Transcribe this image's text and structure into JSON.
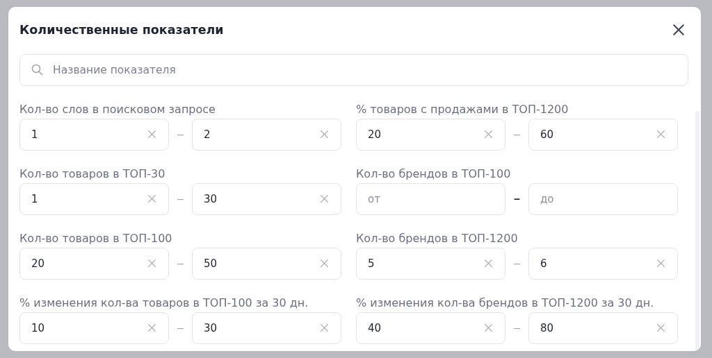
{
  "dialog": {
    "title": "Количественные показатели",
    "search": {
      "placeholder": "Название показателя"
    },
    "filters": [
      {
        "label": "Кол-во слов в поисковом запросе",
        "from": {
          "value": "1"
        },
        "separator": "–",
        "to": {
          "value": "2"
        }
      },
      {
        "label": "% товаров с продажами в ТОП-1200",
        "from": {
          "value": "20"
        },
        "separator": "–",
        "to": {
          "value": "60"
        }
      },
      {
        "label": "Кол-во товаров в ТОП-30",
        "from": {
          "value": "1"
        },
        "separator": "–",
        "to": {
          "value": "30"
        }
      },
      {
        "label": "Кол-во брендов в ТОП-100",
        "from": {
          "placeholder": "от"
        },
        "separator": "–",
        "to": {
          "placeholder": "до"
        }
      },
      {
        "label": "Кол-во товаров в ТОП-100",
        "from": {
          "value": "20"
        },
        "separator": "–",
        "to": {
          "value": "50"
        }
      },
      {
        "label": "Кол-во брендов в ТОП-1200",
        "from": {
          "value": "5"
        },
        "separator": "–",
        "to": {
          "value": "6"
        }
      },
      {
        "label": "% изменения кол-ва товаров в ТОП-100 за 30 дн.",
        "from": {
          "value": "10"
        },
        "separator": "–",
        "to": {
          "value": "30"
        }
      },
      {
        "label": "% изменения кол-ва брендов в ТОП-1200 за 30 дн.",
        "from": {
          "value": "40"
        },
        "separator": "–",
        "to": {
          "value": "80"
        }
      }
    ]
  }
}
